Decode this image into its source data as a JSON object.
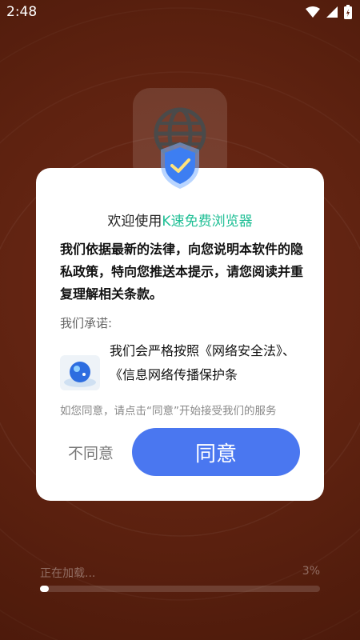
{
  "status_bar": {
    "time": "2:48"
  },
  "dialog": {
    "title_prefix": "欢迎使用",
    "title_highlight": "K速免费浏览器",
    "intro": "我们依据最新的法律，向您说明本软件的隐私政策，特向您推送本提示，请您阅读并重复理解相关条款。",
    "promise_label": "我们承诺:",
    "promise_text": "我们会严格按照《网络安全法》、《信息网络传播保护条",
    "agree_hint": "如您同意，请点击“同意”开始接受我们的服务",
    "disagree_label": "不同意",
    "agree_label": "同意"
  },
  "loading": {
    "label": "正在加载...",
    "percent": "3%",
    "progress": 0.03
  },
  "colors": {
    "accent": "#4a77f0",
    "highlight": "#1fbf95",
    "background": "#5e2210"
  }
}
